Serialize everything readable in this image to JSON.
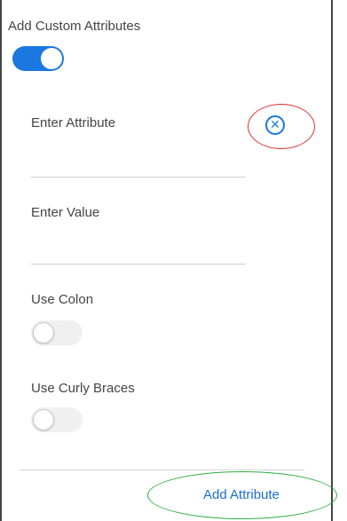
{
  "panel": {
    "title": "Add Custom Attributes",
    "custom_attributes_toggle": {
      "state": "on"
    }
  },
  "attribute_form": {
    "attribute_label": "Enter Attribute",
    "attribute_value": "",
    "value_label": "Enter Value",
    "value_value": "",
    "use_colon": {
      "label": "Use Colon",
      "state": "off"
    },
    "use_curly_braces": {
      "label": "Use Curly Braces",
      "state": "off"
    },
    "remove_icon": "close-circle-icon"
  },
  "footer": {
    "add_attribute_label": "Add Attribute"
  },
  "annotations": {
    "highlight_remove_color": "#e0302a",
    "highlight_add_color": "#2fae3f"
  },
  "colors": {
    "accent": "#1a78e0",
    "link": "#1a6fd0"
  }
}
